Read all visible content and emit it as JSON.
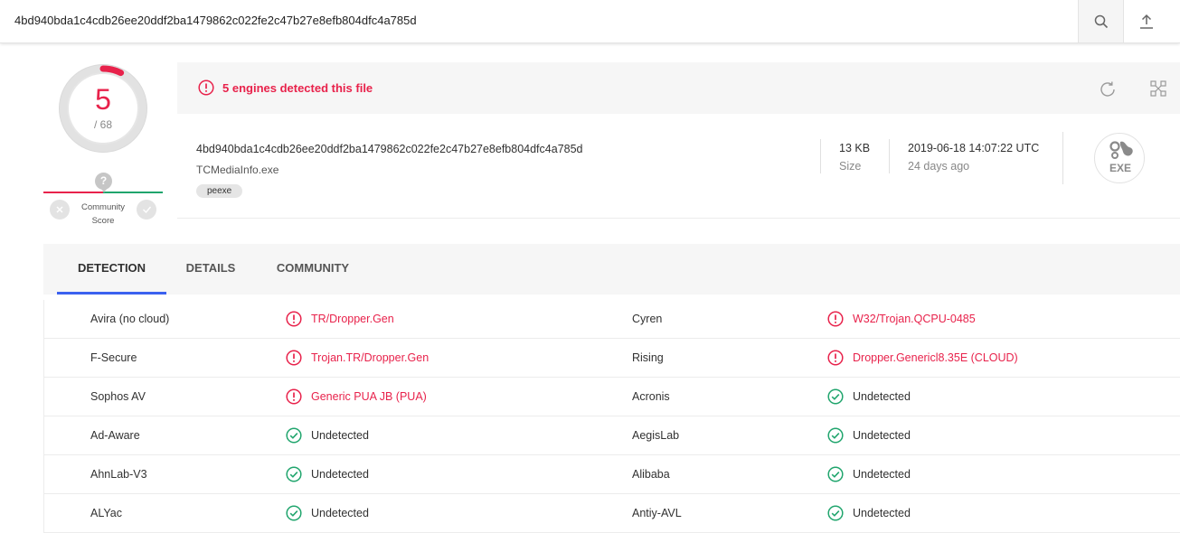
{
  "search": {
    "query": "4bd940bda1c4cdb26ee20ddf2ba1479862c022fe2c47b27e8efb804dfc4a785d"
  },
  "score": {
    "detections": "5",
    "total": "/ 68",
    "ratio": 0.0735
  },
  "community": {
    "label_line1": "Community",
    "label_line2": "Score",
    "marker": "?"
  },
  "banner": {
    "text": "5 engines detected this file"
  },
  "file": {
    "hash": "4bd940bda1c4cdb26ee20ddf2ba1479862c022fe2c47b27e8efb804dfc4a785d",
    "name": "TCMediaInfo.exe",
    "tag": "peexe",
    "size_value": "13 KB",
    "size_label": "Size",
    "date_value": "2019-06-18 14:07:22 UTC",
    "date_label": "24 days ago",
    "type_icon_label": "EXE"
  },
  "tabs": [
    {
      "label": "DETECTION",
      "active": true
    },
    {
      "label": "DETAILS",
      "active": false
    },
    {
      "label": "COMMUNITY",
      "active": false
    }
  ],
  "colors": {
    "malicious": "#e8224b",
    "clean": "#20a56d",
    "accent": "#3b61ef"
  },
  "detections": [
    {
      "left": {
        "engine": "Avira (no cloud)",
        "result": "TR/Dropper.Gen",
        "status": "malicious"
      },
      "right": {
        "engine": "Cyren",
        "result": "W32/Trojan.QCPU-0485",
        "status": "malicious"
      }
    },
    {
      "left": {
        "engine": "F-Secure",
        "result": "Trojan.TR/Dropper.Gen",
        "status": "malicious"
      },
      "right": {
        "engine": "Rising",
        "result": "Dropper.Genericl8.35E (CLOUD)",
        "status": "malicious"
      }
    },
    {
      "left": {
        "engine": "Sophos AV",
        "result": "Generic PUA JB (PUA)",
        "status": "malicious"
      },
      "right": {
        "engine": "Acronis",
        "result": "Undetected",
        "status": "clean"
      }
    },
    {
      "left": {
        "engine": "Ad-Aware",
        "result": "Undetected",
        "status": "clean"
      },
      "right": {
        "engine": "AegisLab",
        "result": "Undetected",
        "status": "clean"
      }
    },
    {
      "left": {
        "engine": "AhnLab-V3",
        "result": "Undetected",
        "status": "clean"
      },
      "right": {
        "engine": "Alibaba",
        "result": "Undetected",
        "status": "clean"
      }
    },
    {
      "left": {
        "engine": "ALYac",
        "result": "Undetected",
        "status": "clean"
      },
      "right": {
        "engine": "Antiy-AVL",
        "result": "Undetected",
        "status": "clean"
      }
    }
  ]
}
